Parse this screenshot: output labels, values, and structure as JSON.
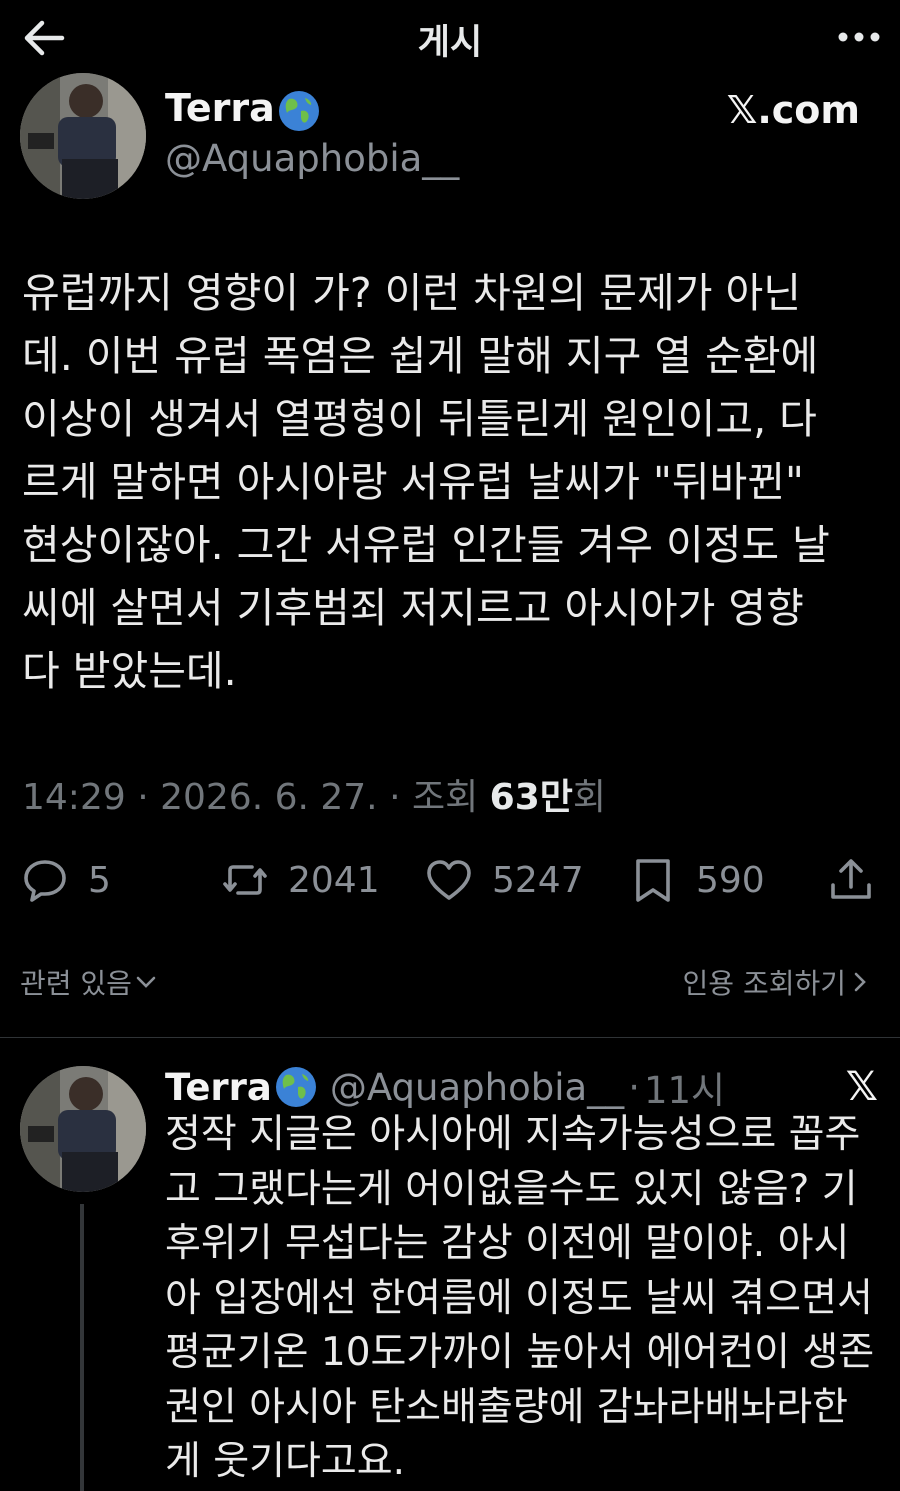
{
  "header": {
    "title": "게시",
    "back_icon": "arrow-left-icon",
    "more_icon": "more-horizontal-icon"
  },
  "post": {
    "author": {
      "name": "Terra",
      "name_emoji": "globe-asia-icon",
      "handle": "@Aquaphobia__"
    },
    "watermark": "𝕏.com",
    "text": "유럽까지 영향이 가? 이런 차원의 문제가 아닌\n데. 이번 유럽 폭염은 쉽게 말해 지구 열 순환에\n이상이 생겨서 열평형이 뒤틀린게 원인이고, 다\n르게 말하면 아시아랑 서유럽 날씨가 \"뒤바뀐\"\n현상이잖아. 그간 서유럽 인간들 겨우 이정도 날\n씨에 살면서 기후범죄 저지르고 아시아가 영향\n다 받았는데.",
    "meta": {
      "prefix": "14:29 · 2026. 6. 27. · 조회 ",
      "views": "63만",
      "suffix": "회"
    },
    "actions": {
      "replies": "5",
      "reposts": "2041",
      "likes": "5247",
      "bookmarks": "590"
    },
    "related_label": "관련 있음",
    "quote_views_label": "인용 조회하기"
  },
  "reply": {
    "author": {
      "name": "Terra",
      "handle": "@Aquaphobia__",
      "time": "11시"
    },
    "text": "정작 지글은 아시아에 지속가능성으로 꼽주\n고 그랬다는게 어이없을수도 있지 않음? 기\n후위기 무섭다는 감상 이전에 말이야. 아시\n아 입장에선 한여름에 이정도 날씨 겪으면서\n평균기온 10도가까이 높아서 에어컨이 생존\n권인 아시아 탄소배출량에 감놔라배놔라한\n게 웃기다고요.",
    "more_label": "𝕏"
  },
  "colors": {
    "background": "#000000",
    "text": "#e7e9ea",
    "muted": "#71767b",
    "divider": "#2f3336"
  }
}
